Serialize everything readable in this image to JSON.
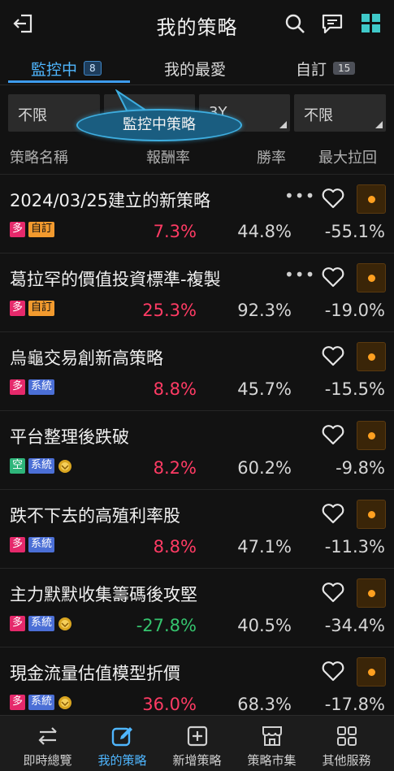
{
  "header": {
    "title": "我的策略"
  },
  "tabs": [
    {
      "label": "監控中",
      "count": "8"
    },
    {
      "label": "我的最愛",
      "count": ""
    },
    {
      "label": "自訂",
      "count": "15"
    }
  ],
  "filters": [
    "不限",
    "",
    "3Y",
    "不限"
  ],
  "tooltip": "監控中策略",
  "columns": {
    "name": "策略名稱",
    "return": "報酬率",
    "win": "勝率",
    "drawdown": "最大拉回"
  },
  "rows": [
    {
      "name": "2024/03/25建立的新策略",
      "tags": [
        "多",
        "自訂"
      ],
      "return": "7.3%",
      "win": "44.8%",
      "drawdown": "-55.1%"
    },
    {
      "name": "葛拉罕的價值投資標準-複製",
      "tags": [
        "多",
        "自訂"
      ],
      "return": "25.3%",
      "win": "92.3%",
      "drawdown": "-19.0%"
    },
    {
      "name": "烏龜交易創新高策略",
      "tags": [
        "多",
        "系統"
      ],
      "return": "8.8%",
      "win": "45.7%",
      "drawdown": "-15.5%"
    },
    {
      "name": "平台整理後跌破",
      "tags": [
        "空",
        "系統"
      ],
      "return": "8.2%",
      "win": "60.2%",
      "drawdown": "-9.8%"
    },
    {
      "name": "跌不下去的高殖利率股",
      "tags": [
        "多",
        "系統"
      ],
      "return": "8.8%",
      "win": "47.1%",
      "drawdown": "-11.3%"
    },
    {
      "name": "主力默默收集籌碼後攻堅",
      "tags": [
        "多",
        "系統"
      ],
      "return": "-27.8%",
      "win": "40.5%",
      "drawdown": "-34.4%"
    },
    {
      "name": "現金流量估值模型折價",
      "tags": [
        "多",
        "系統"
      ],
      "return": "36.0%",
      "win": "68.3%",
      "drawdown": "-17.8%"
    }
  ],
  "nav": [
    {
      "label": "即時總覽"
    },
    {
      "label": "我的策略"
    },
    {
      "label": "新增策略"
    },
    {
      "label": "策略市集"
    },
    {
      "label": "其他服務"
    }
  ],
  "colors": {
    "accent": "#4fb6ff",
    "positive": "#ff3b64",
    "negative": "#35c46e",
    "monitor_dot": "#ffa020"
  }
}
